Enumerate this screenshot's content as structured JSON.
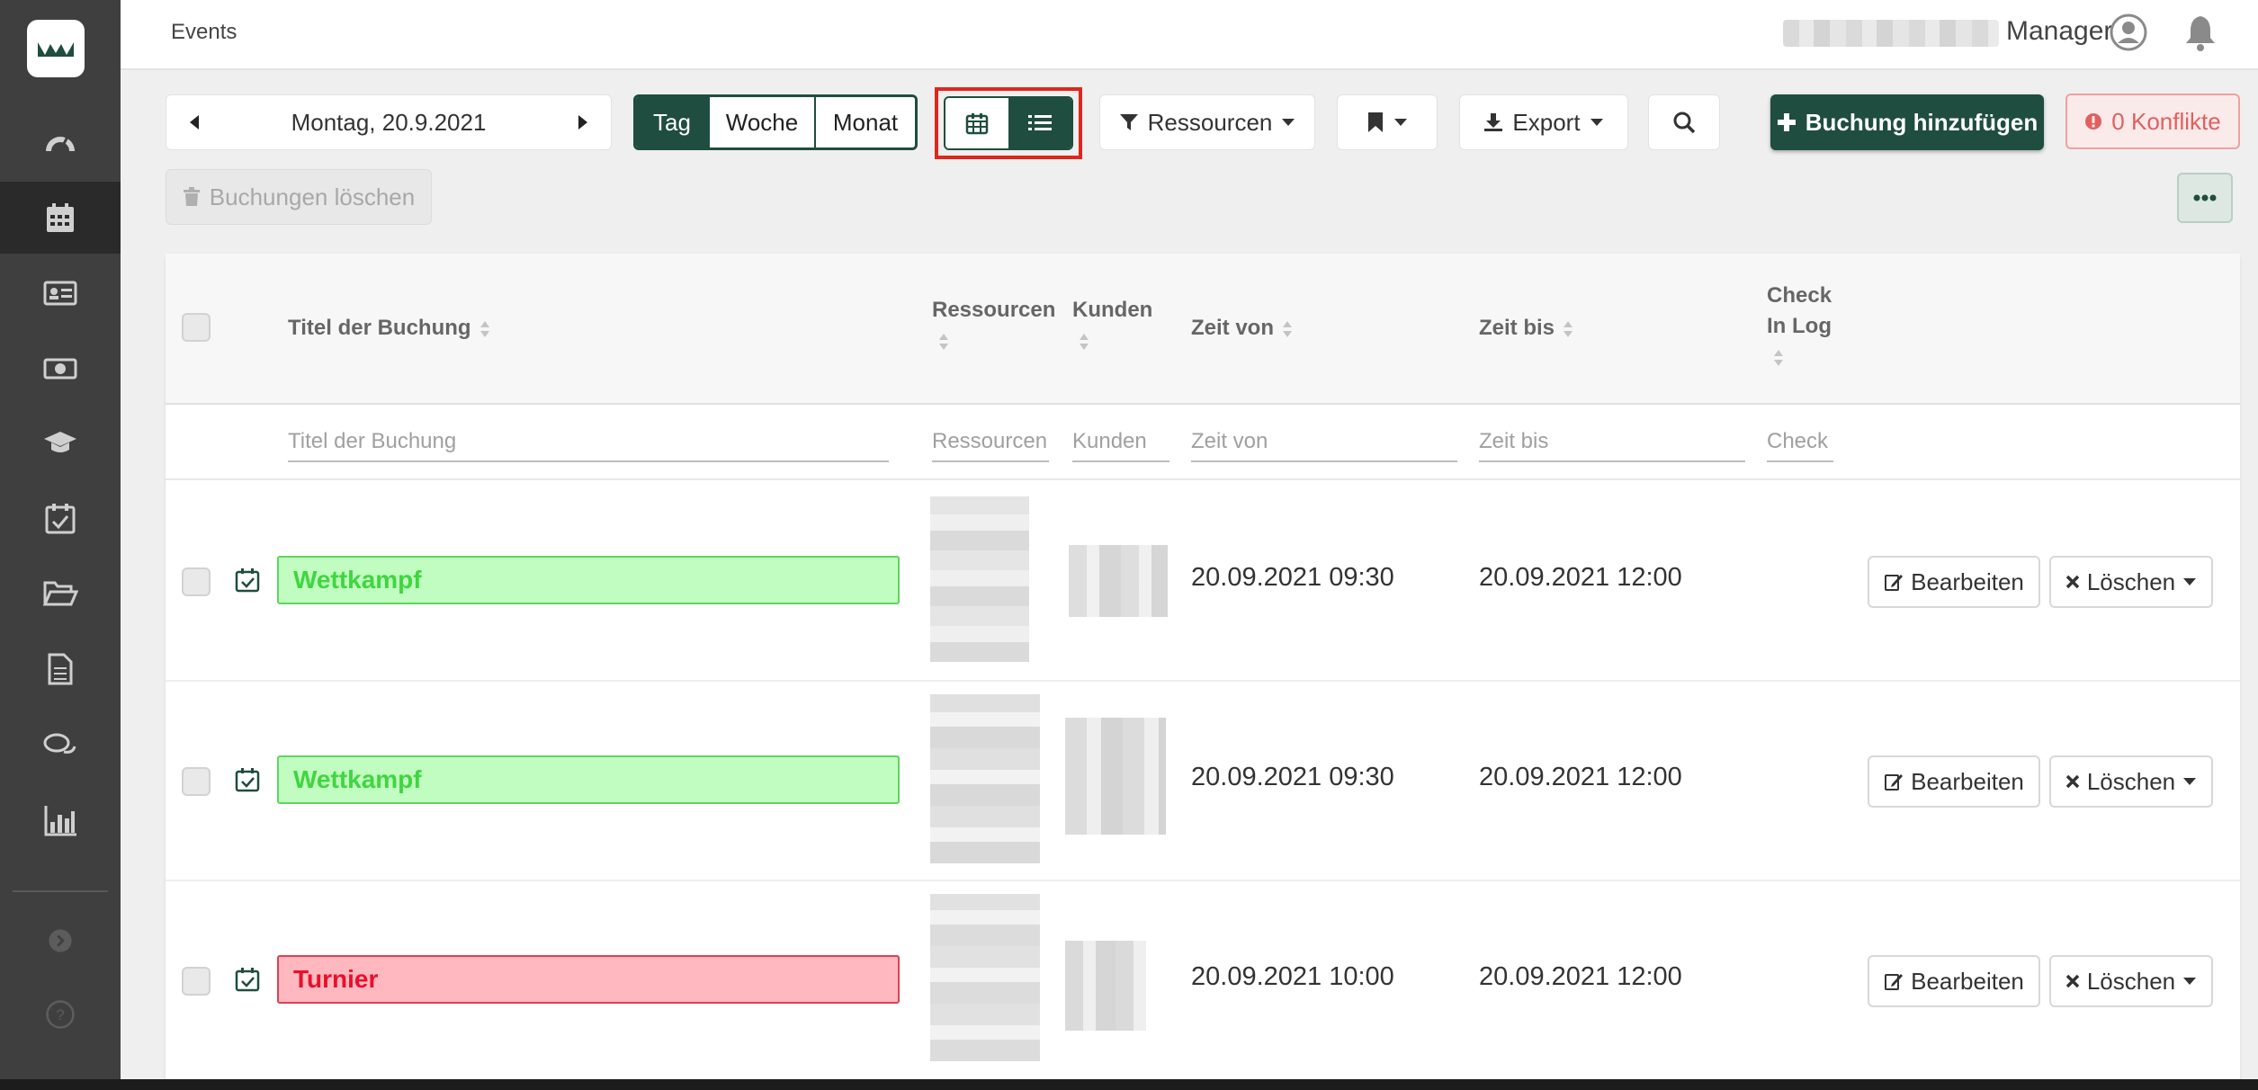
{
  "header": {
    "breadcrumb": "Events",
    "role": "Manager"
  },
  "toolbar": {
    "date_label": "Montag, 20.9.2021",
    "range_tabs": [
      "Tag",
      "Woche",
      "Monat"
    ],
    "range_selected": "Tag",
    "view_selected": "list",
    "resources_label": "Ressourcen",
    "export_label": "Export",
    "add_booking_label": "Buchung hinzufügen",
    "conflicts_label": "0 Konflikte",
    "delete_bookings_label": "Buchungen löschen"
  },
  "table": {
    "columns": {
      "title": "Titel der Buchung",
      "resources": "Ressourcen",
      "customers": "Kunden",
      "time_from": "Zeit von",
      "time_to": "Zeit bis",
      "checkin_line1": "Check",
      "checkin_line2": "In Log"
    },
    "filters": {
      "title": "Titel der Buchung",
      "resources": "Ressourcen",
      "customers": "Kunden",
      "time_from": "Zeit von",
      "time_to": "Zeit bis",
      "checkin": "Check"
    },
    "rows": [
      {
        "title": "Wettkampf",
        "status": "green",
        "time_from": "20.09.2021 09:30",
        "time_to": "20.09.2021 12:00",
        "edit_label": "Bearbeiten",
        "delete_label": "Löschen"
      },
      {
        "title": "Wettkampf",
        "status": "green",
        "time_from": "20.09.2021 09:30",
        "time_to": "20.09.2021 12:00",
        "edit_label": "Bearbeiten",
        "delete_label": "Löschen"
      },
      {
        "title": "Turnier",
        "status": "red",
        "time_from": "20.09.2021 10:00",
        "time_to": "20.09.2021 12:00",
        "edit_label": "Bearbeiten",
        "delete_label": "Löschen"
      }
    ]
  },
  "colors": {
    "brand": "#1f4d3f",
    "highlight": "#e0261b",
    "status_green": "#3fd63f",
    "status_red": "#e8102a"
  },
  "icons": [
    "logo-icon",
    "dashboard-icon",
    "calendar-icon",
    "id-card-icon",
    "money-icon",
    "graduation-cap-icon",
    "calendar-check-icon",
    "folder-open-icon",
    "document-icon",
    "chat-icon",
    "bar-chart-icon",
    "chevron-circle-right-icon",
    "question-circle-icon"
  ]
}
